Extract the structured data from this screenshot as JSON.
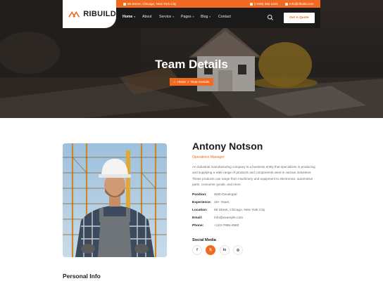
{
  "brand": {
    "name": "RIBUILD",
    "accent": "#f26a21",
    "dark": "#1a1a1a"
  },
  "topbar": {
    "address": "59 Street, Chicago, New York City",
    "phone": "(+045) 392 1123",
    "email": "Info@ribuild.com"
  },
  "nav": {
    "items": [
      {
        "label": "Home",
        "caret": "▾"
      },
      {
        "label": "About"
      },
      {
        "label": "Service",
        "caret": "▾"
      },
      {
        "label": "Pages",
        "caret": "▾"
      },
      {
        "label": "Blog",
        "caret": "▾"
      },
      {
        "label": "Contact"
      }
    ],
    "quote_button": "Get A Quote"
  },
  "hero": {
    "title": "Team Details",
    "breadcrumb": {
      "home": "Home",
      "separator": "»",
      "current": "Team Details"
    }
  },
  "profile": {
    "name": "Antony Notson",
    "role": "Operations Manager",
    "bio": "An industrial manufacturing company is a business entity that specializes in producing and supplying a wide range of products and components used in various industries. These products can range from machinery and equipment to electronics, automotive parts, consumer goods, and more.",
    "details": [
      {
        "label": "Position:",
        "value": "Web Developer"
      },
      {
        "label": "Experience:",
        "value": "15+ Years"
      },
      {
        "label": "Location:",
        "value": "59 Street, Chicago, New York City"
      },
      {
        "label": "Email:",
        "value": "info@example.com"
      },
      {
        "label": "Phone:",
        "value": "+123-7655-4560"
      }
    ],
    "social_title": "Social Media",
    "social": [
      {
        "icon": "facebook-icon",
        "glyph": "f"
      },
      {
        "icon": "x-icon",
        "glyph": "𝕏"
      },
      {
        "icon": "linkedin-icon",
        "glyph": "in"
      },
      {
        "icon": "instagram-icon",
        "glyph": "◎"
      }
    ]
  },
  "personal_info_title": "Personal Info"
}
